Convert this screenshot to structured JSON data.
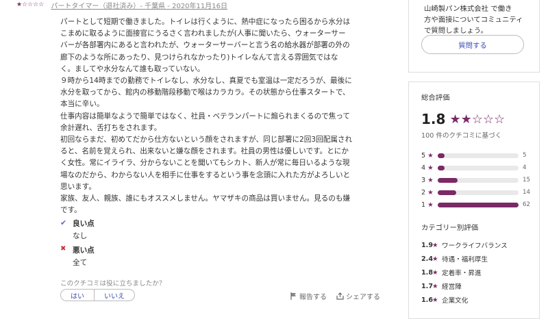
{
  "review": {
    "stars": "★☆☆☆☆",
    "meta": "パートタイマー（退社済み）- 千葉県 - 2020年11月16日",
    "body": "パートとして短期で働きました。トイレは行くように、熱中症になったら困るから水分は\nこまめに取るように面接官にうるさく言われましたが(人事に聞いたら、ウォーターサー\nバーが各部署内にあると言われたが、ウォーターサーバーと言う名の給水器が部署の外の\n廊下のような所にあったり、見つけられなかったり)トイレなんて言える雰囲気ではな\nく。ましてや水分なんて誰も取っていない。\n９時から14時までの勤務でトイレなし、水分なし、真夏でも室温は一定だろうが、最後に\n水分を取ってから、館内の移動階段移動で喉はカラカラ。その状態から仕事スタートで、\n本当に辛い。\n仕事内容は簡単なようで簡単ではなく、社員・ベテランパートに煽られまくるので焦って\n余計遅れ、舌打ちをされます。\n初回ならまだ、初めてだから仕方ないという顔をされますが、同じ部署に2回3回配属され\nると、名前を覚えられ、出来ないと嫌な顔をされます。社員の男性は優しいです。とにか\nく女性。常にイライラ、分からないことを聞いてもシカト、新人が常に毎日いるような現\n場なのだから、わからない人を相手に仕事をするという事を念頭に入れた方がよろしいと\n思います。\n家族、友人、親族、誰にもオススメしません。ヤマザキの商品は買いません。見るのも嫌\nです。",
    "good_title": "良い点",
    "good_value": "なし",
    "bad_title": "悪い点",
    "bad_value": "全て",
    "helpful_question": "このクチコミは役に立ちましたか？",
    "yes_label": "はい",
    "no_label": "いいえ",
    "report_label": "報告する",
    "share_label": "シェアする"
  },
  "ask": {
    "text": "山崎製パン株式会社 で働き\n方や面接についてコミュニティ\nで質問しましょう。",
    "button_label": "質問する"
  },
  "summary": {
    "title": "総合評価",
    "score": "1.8",
    "stars": "★★☆☆☆",
    "count_note": "100 件のクチコミに基づく",
    "colors": {
      "accent": "#7a2a66"
    }
  },
  "chart_data": {
    "type": "bar",
    "categories": [
      "5",
      "4",
      "3",
      "2",
      "1"
    ],
    "values": [
      5,
      4,
      15,
      14,
      62
    ],
    "xlim": [
      0,
      62
    ]
  },
  "category_section": {
    "title": "カテゴリー別評価",
    "items": [
      {
        "score": "1.9",
        "label": "ワークライフバランス"
      },
      {
        "score": "2.4",
        "label": "待遇・福利厚生"
      },
      {
        "score": "1.8",
        "label": "定着率・昇進"
      },
      {
        "score": "1.7",
        "label": "経営陣"
      },
      {
        "score": "1.6",
        "label": "企業文化"
      }
    ]
  }
}
